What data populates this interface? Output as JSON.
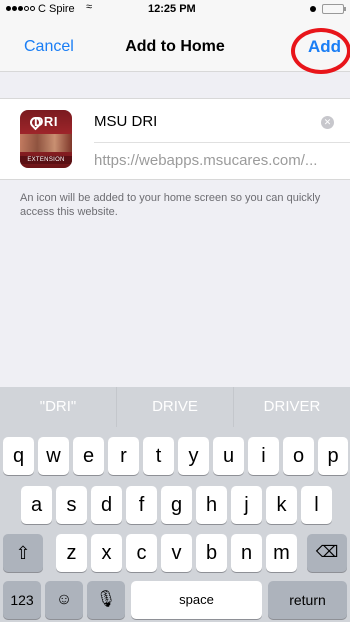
{
  "status": {
    "carrier": "C Spire",
    "time": "12:25 PM"
  },
  "nav": {
    "cancel": "Cancel",
    "title": "Add to Home",
    "add": "Add"
  },
  "card": {
    "icon_label": "DRI",
    "icon_sub": "EXTENSION",
    "name": "MSU DRI",
    "url": "https://webapps.msucares.com/..."
  },
  "info": "An icon will be added to your home screen so you can quickly access this website.",
  "suggestions": [
    "\"DRI\"",
    "DRIVE",
    "DRIVER"
  ],
  "keyboard": {
    "row1": [
      "q",
      "w",
      "e",
      "r",
      "t",
      "y",
      "u",
      "i",
      "o",
      "p"
    ],
    "row2": [
      "a",
      "s",
      "d",
      "f",
      "g",
      "h",
      "j",
      "k",
      "l"
    ],
    "row3": [
      "z",
      "x",
      "c",
      "v",
      "b",
      "n",
      "m"
    ],
    "numbers": "123",
    "space": "space",
    "return": "return"
  },
  "colors": {
    "accent": "#1a7ef5",
    "highlight": "#e8151a"
  }
}
